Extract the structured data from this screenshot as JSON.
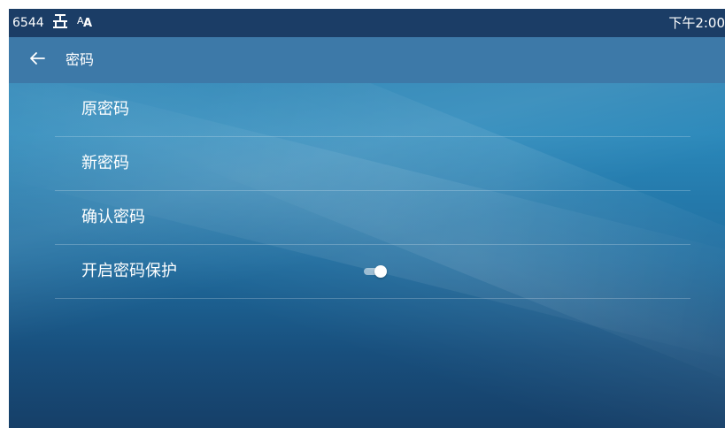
{
  "status_bar": {
    "extension": "6544",
    "icons": [
      "network-icon",
      "font-size-icon"
    ],
    "time": "下午2:00"
  },
  "title_bar": {
    "back_icon": "back-arrow-icon",
    "title": "密码"
  },
  "settings": {
    "items": [
      {
        "label": "原密码"
      },
      {
        "label": "新密码"
      },
      {
        "label": "确认密码"
      },
      {
        "label": "开启密码保护",
        "toggle_on": true
      }
    ]
  },
  "colors": {
    "status_bar_bg": "#1b3d66",
    "title_bar_bg": "#3d79a8",
    "toggle_on": "#ffffff"
  }
}
